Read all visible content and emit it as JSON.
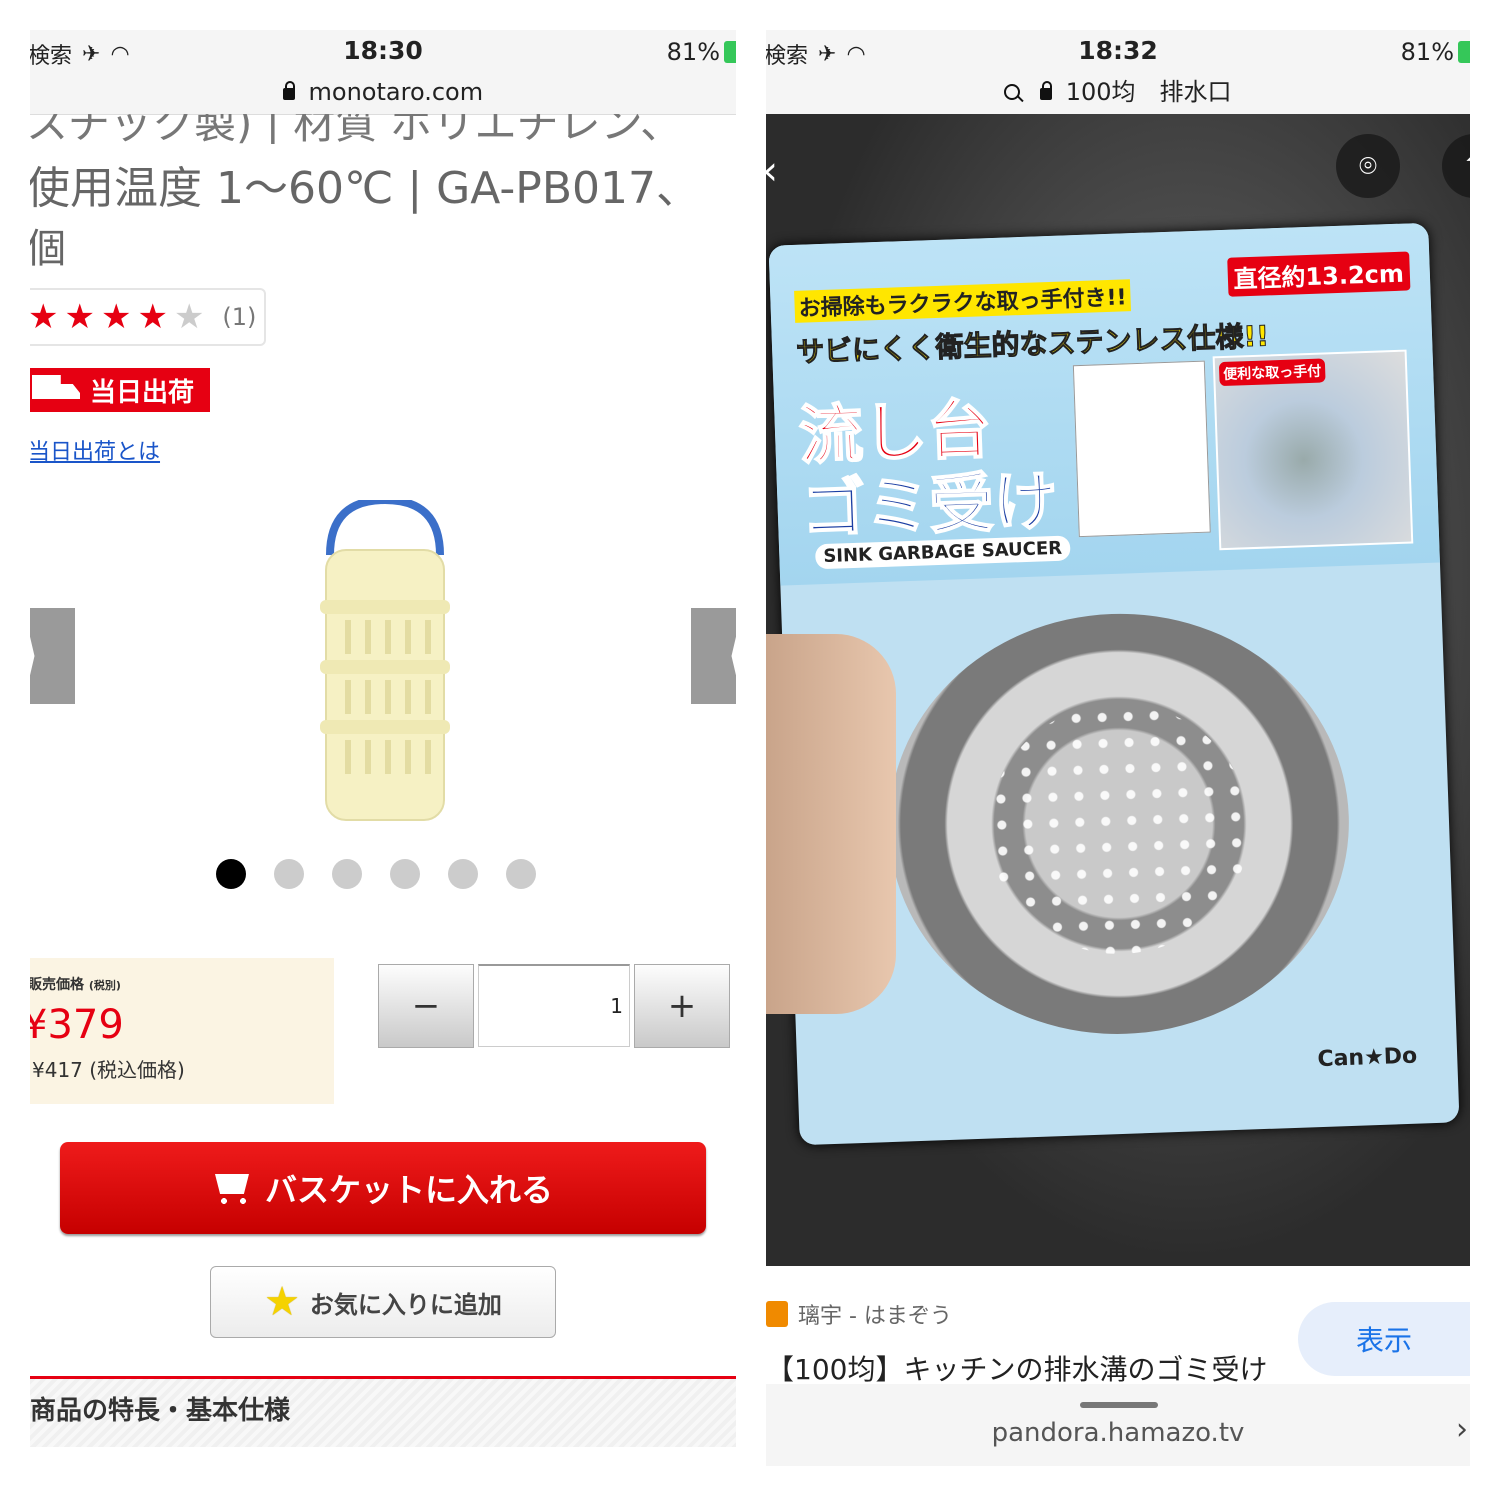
{
  "left": {
    "status": {
      "carrier": "検索",
      "time": "18:30",
      "battery": "81%"
    },
    "url": "monotaro.com",
    "spec_line1": "スチック製)  |  材質 ポリエチレン、",
    "spec_line2": "使用温度 1〜60℃  |  GA-PB017、",
    "spec_line3": "個",
    "rating": {
      "stars": 4,
      "max": 5,
      "count": "(1)"
    },
    "ship_badge": "当日出荷",
    "ship_link": "当日出荷とは",
    "image_dots": {
      "total": 6,
      "active": 1
    },
    "price": {
      "label": "販売価格",
      "label_note": "(税別)",
      "value": "¥379",
      "tax_incl": "¥417 (税込価格)"
    },
    "quantity": {
      "minus": "−",
      "value": "1",
      "plus": "+"
    },
    "cart_button": "バスケットに入れる",
    "fav_button": "お気に入りに追加",
    "section_heading": "商品の特長・基本仕様"
  },
  "right": {
    "status": {
      "carrier": "検索",
      "time": "18:32",
      "battery": "81%"
    },
    "search_query": "100均　排水口",
    "package": {
      "sub1": "お掃除もラクラクな取っ手付き!!",
      "sub2": "サビにくく衛生的なステンレス仕様!!",
      "diameter": "直径約13.2cm",
      "title1": "流し台",
      "title2": "ゴミ受け",
      "english": "SINK GARBAGE SAUCER",
      "handle_label": "便利な取っ手付",
      "brand": "Can★Do"
    },
    "source": "璃宇 - はまぞう",
    "show_button": "表示",
    "result_title": "【100均】キッチンの排水溝のゴミ受け",
    "bottom_url": "pandora.hamazo.tv"
  }
}
